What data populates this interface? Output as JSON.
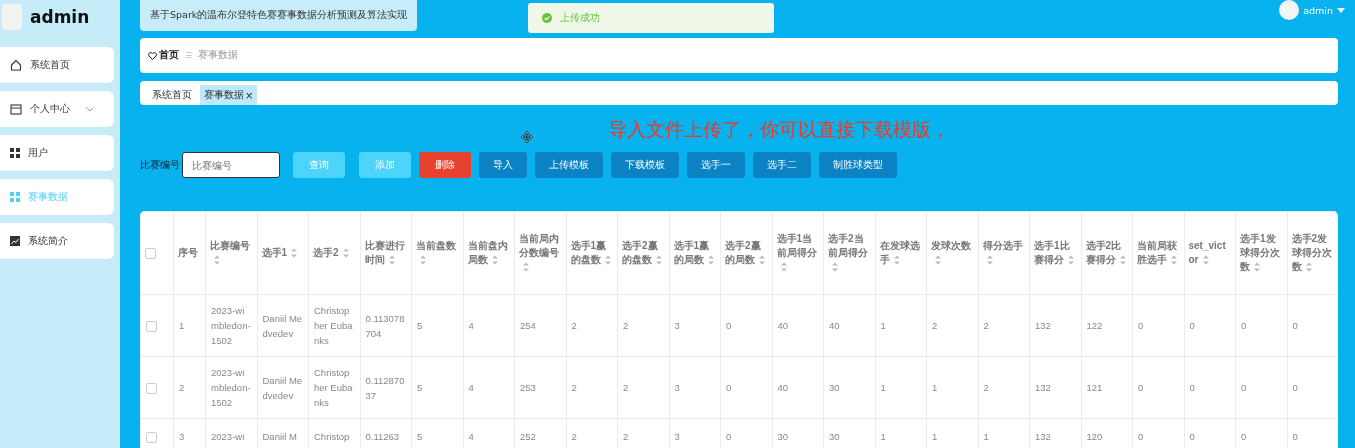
{
  "sidebar": {
    "title": "admin",
    "items": [
      {
        "label": "系统首页",
        "selected": false,
        "expandable": false
      },
      {
        "label": "个人中心",
        "selected": false,
        "expandable": true
      },
      {
        "label": "用户",
        "selected": false,
        "expandable": false
      },
      {
        "label": "赛事数据",
        "selected": true,
        "expandable": false
      },
      {
        "label": "系统简介",
        "selected": false,
        "expandable": false
      }
    ]
  },
  "header": {
    "project_title": "基于Spark的温布尔登特色赛赛事数据分析预测及算法实现",
    "toast": "上传成功",
    "user": "admin"
  },
  "breadcrumb": {
    "home": "首页",
    "separator": "☰",
    "current": "赛事数据"
  },
  "tags": [
    {
      "label": "系统首页",
      "selected": false
    },
    {
      "label": "赛事数据",
      "selected": true,
      "close": "×"
    }
  ],
  "annotation": "导入文件上传了，你可以直接下载模版，",
  "search": {
    "label": "比赛编号",
    "placeholder": "比赛编号"
  },
  "buttons": [
    {
      "label": "查询",
      "kind": "light"
    },
    {
      "label": "添加",
      "kind": "light"
    },
    {
      "label": "删除",
      "kind": "danger"
    },
    {
      "label": "导入",
      "kind": "primary"
    },
    {
      "label": "上传模板",
      "kind": "primary"
    },
    {
      "label": "下载模板",
      "kind": "primary"
    },
    {
      "label": "选手一",
      "kind": "primary"
    },
    {
      "label": "选手二",
      "kind": "primary"
    },
    {
      "label": "制胜球类型",
      "kind": "primary"
    }
  ],
  "table": {
    "all_checked": false,
    "columns": [
      {
        "label": "序号",
        "sortable": false
      },
      {
        "label": "比赛编号",
        "sortable": true
      },
      {
        "label": "选手1",
        "sortable": true
      },
      {
        "label": "选手2",
        "sortable": true
      },
      {
        "label": "比赛进行时间",
        "sortable": true
      },
      {
        "label": "当前盘数",
        "sortable": true
      },
      {
        "label": "当前盘内局数",
        "sortable": true
      },
      {
        "label": "当前局内分数编号",
        "sortable": true
      },
      {
        "label": "选手1赢的盘数",
        "sortable": true
      },
      {
        "label": "选手2赢的盘数",
        "sortable": true
      },
      {
        "label": "选手1赢的局数",
        "sortable": true
      },
      {
        "label": "选手2赢的局数",
        "sortable": true
      },
      {
        "label": "选手1当前局得分",
        "sortable": true
      },
      {
        "label": "选手2当前局得分",
        "sortable": true
      },
      {
        "label": "在发球选手",
        "sortable": true
      },
      {
        "label": "发球次数",
        "sortable": true
      },
      {
        "label": "得分选手",
        "sortable": true
      },
      {
        "label": "选手1比赛得分",
        "sortable": true
      },
      {
        "label": "选手2比赛得分",
        "sortable": true
      },
      {
        "label": "当前局获胜选手",
        "sortable": true
      },
      {
        "label": "set_victor",
        "sortable": true
      },
      {
        "label": "选手1发球得分次数",
        "sortable": true
      },
      {
        "label": "选手2发球得分次数",
        "sortable": true
      }
    ],
    "rows": [
      {
        "checked": false,
        "cells": [
          "1",
          "2023-wimbledon-1502",
          "Daniil Medvedev",
          "Christopher Eubanks",
          "0.113078704",
          "5",
          "4",
          "254",
          "2",
          "2",
          "3",
          "0",
          "40",
          "40",
          "1",
          "2",
          "2",
          "132",
          "122",
          "0",
          "0",
          "0",
          "0"
        ]
      },
      {
        "checked": false,
        "cells": [
          "2",
          "2023-wimbledon-1502",
          "Daniil Medvedev",
          "Christopher Eubanks",
          "0.11287037",
          "5",
          "4",
          "253",
          "2",
          "2",
          "3",
          "0",
          "40",
          "30",
          "1",
          "1",
          "2",
          "132",
          "121",
          "0",
          "0",
          "0",
          "0"
        ]
      },
      {
        "checked": false,
        "cells": [
          "3",
          "2023-wi",
          "Daniil M",
          "Christop",
          "0.11263",
          "5",
          "4",
          "252",
          "2",
          "2",
          "3",
          "0",
          "30",
          "30",
          "1",
          "1",
          "1",
          "132",
          "120",
          "0",
          "0",
          "0",
          "0"
        ]
      }
    ]
  }
}
